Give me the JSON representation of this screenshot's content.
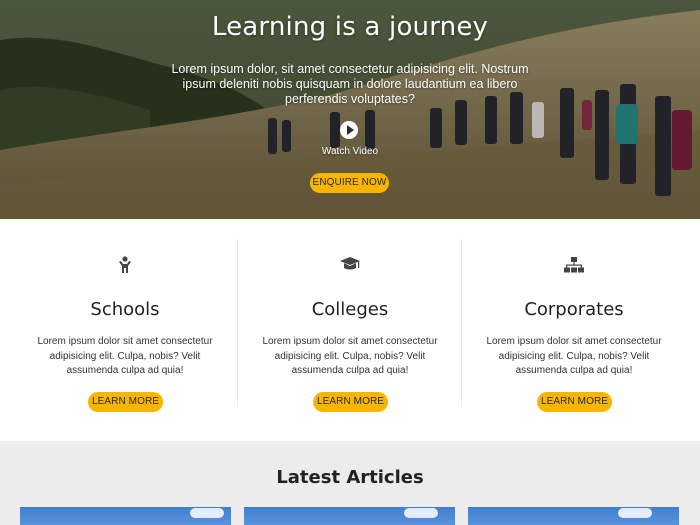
{
  "hero": {
    "title": "Learning is a journey",
    "text": "Lorem ipsum dolor, sit amet consectetur adipisicing elit. Nostrum ipsum deleniti nobis quisquam in dolore laudantium ea libero perferendis voluptates?",
    "watch_label": "Watch Video",
    "cta_label": "ENQUIRE NOW",
    "play_icon": "play-icon"
  },
  "features": [
    {
      "icon": "child-icon",
      "title": "Schools",
      "text": "Lorem ipsum dolor sit amet consectetur adipisicing elit. Culpa, nobis? Velit assumenda culpa ad quia!",
      "button": "LEARN MORE"
    },
    {
      "icon": "graduation-cap-icon",
      "title": "Colleges",
      "text": "Lorem ipsum dolor sit amet consectetur adipisicing elit. Culpa, nobis? Velit assumenda culpa ad quia!",
      "button": "LEARN MORE"
    },
    {
      "icon": "sitemap-icon",
      "title": "Corporates",
      "text": "Lorem ipsum dolor sit amet consectetur adipisicing elit. Culpa, nobis? Velit assumenda culpa ad quia!",
      "button": "LEARN MORE"
    }
  ],
  "articles": {
    "title": "Latest Articles"
  },
  "colors": {
    "accent": "#f7b500",
    "section_bg": "#ececec",
    "text_dark": "#222222"
  }
}
